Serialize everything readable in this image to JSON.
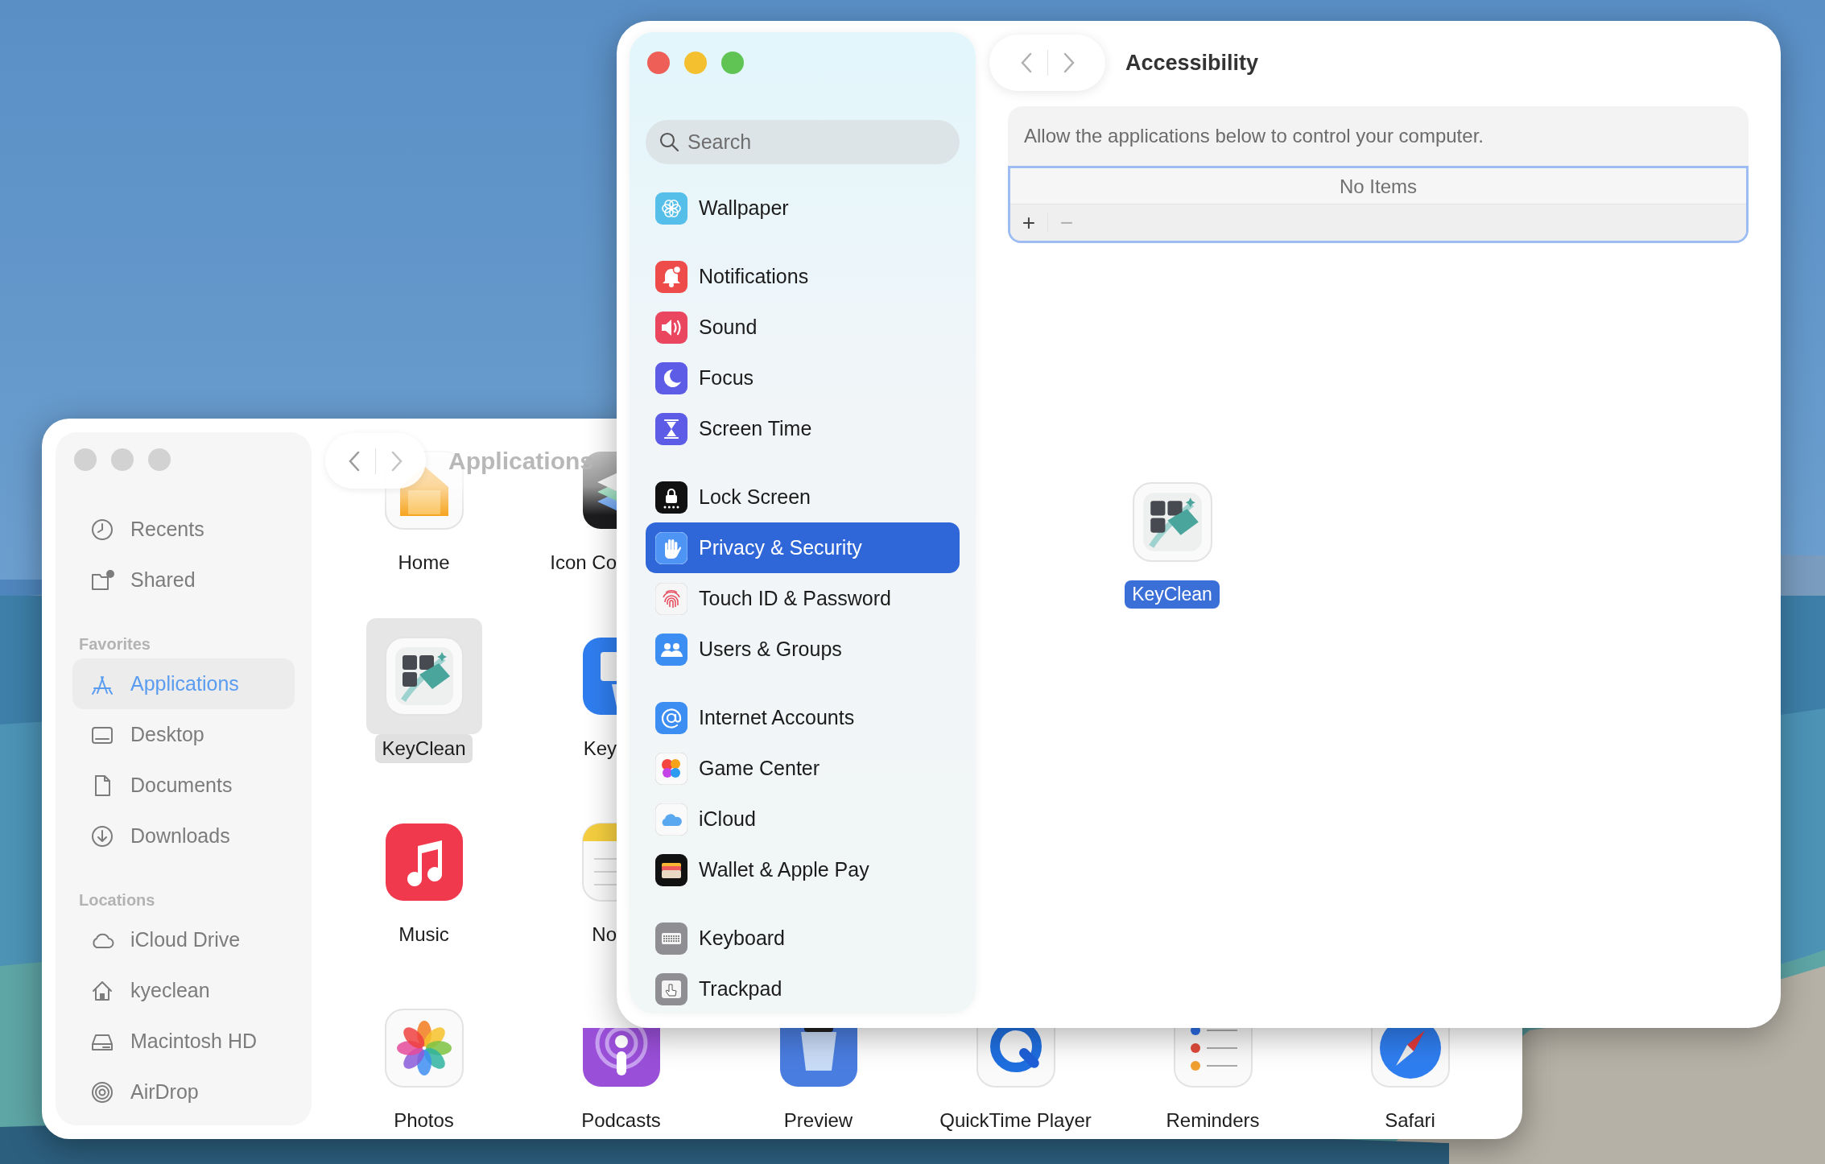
{
  "finder": {
    "title": "Applications",
    "sidebar": [
      {
        "items": [
          {
            "label": "Recents",
            "selected": false
          },
          {
            "label": "Shared",
            "selected": false
          }
        ]
      },
      {
        "heading": "Favorites",
        "items": [
          {
            "label": "Applications",
            "selected": true
          },
          {
            "label": "Desktop",
            "selected": false
          },
          {
            "label": "Documents",
            "selected": false
          },
          {
            "label": "Downloads",
            "selected": false
          }
        ]
      },
      {
        "heading": "Locations",
        "items": [
          {
            "label": "iCloud Drive",
            "selected": false
          },
          {
            "label": "kyeclean",
            "selected": false
          },
          {
            "label": "Macintosh HD",
            "selected": false
          },
          {
            "label": "AirDrop",
            "selected": false
          }
        ]
      }
    ],
    "rows": [
      [
        {
          "label": "Home",
          "selected": false
        },
        {
          "label": "Icon Co",
          "selected": false
        }
      ],
      [
        {
          "label": "KeyClean",
          "selected": true
        },
        {
          "label": "Key",
          "selected": false
        }
      ],
      [
        {
          "label": "Music",
          "selected": false
        },
        {
          "label": "No",
          "selected": false
        }
      ],
      [
        {
          "label": "Photos",
          "selected": false
        },
        {
          "label": "Podcasts",
          "selected": false
        },
        {
          "label": "Preview",
          "selected": false
        },
        {
          "label": "QuickTime Player",
          "selected": false
        },
        {
          "label": "Reminders",
          "selected": false
        },
        {
          "label": "Safari",
          "selected": false
        }
      ]
    ]
  },
  "settings": {
    "search": {
      "placeholder": "Search"
    },
    "sidebar": [
      {
        "items": [
          {
            "label": "Wallpaper",
            "selected": false
          }
        ]
      },
      {
        "items": [
          {
            "label": "Notifications",
            "selected": false
          },
          {
            "label": "Sound",
            "selected": false
          },
          {
            "label": "Focus",
            "selected": false
          },
          {
            "label": "Screen Time",
            "selected": false
          }
        ]
      },
      {
        "items": [
          {
            "label": "Lock Screen",
            "selected": false
          },
          {
            "label": "Privacy & Security",
            "selected": true
          },
          {
            "label": "Touch ID & Password",
            "selected": false
          },
          {
            "label": "Users & Groups",
            "selected": false
          }
        ]
      },
      {
        "items": [
          {
            "label": "Internet Accounts",
            "selected": false
          },
          {
            "label": "Game Center",
            "selected": false
          },
          {
            "label": "iCloud",
            "selected": false
          },
          {
            "label": "Wallet & Apple Pay",
            "selected": false
          }
        ]
      },
      {
        "items": [
          {
            "label": "Keyboard",
            "selected": false
          },
          {
            "label": "Trackpad",
            "selected": false
          }
        ]
      }
    ],
    "title": "Accessibility",
    "description": "Allow the applications below to control your computer.",
    "list": {
      "empty_text": "No Items",
      "buttons": [
        "+",
        "−"
      ]
    }
  },
  "drag": {
    "label": "KeyClean"
  }
}
